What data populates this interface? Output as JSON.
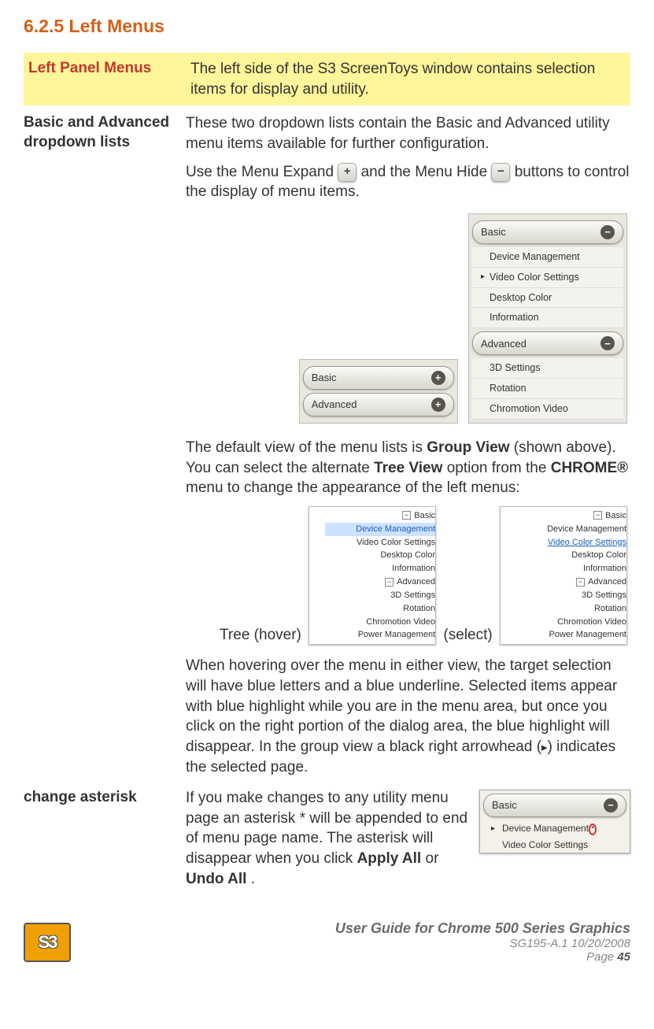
{
  "heading": "6.2.5 Left Menus",
  "rows": {
    "left_panel": {
      "label": "Left Panel Menus",
      "text": "The left side of the S3 ScreenToys window contains selection items for display and utility."
    },
    "dropdowns": {
      "label": "Basic and Advanced dropdown lists",
      "p1": "These two dropdown lists contain the Basic and Advanced utility menu items available for further configuration.",
      "p2a": "Use the Menu Expand ",
      "p2b": "and the Menu Hide ",
      "p2c": " buttons to control the display of menu items.",
      "expand_sym": "+",
      "hide_sym": "−",
      "p3a": "The default view of the menu lists is ",
      "p3b": "Group View",
      "p3c": " (shown above). You can select the alternate ",
      "p3d": "Tree View",
      "p3e": " option from the ",
      "p3f": "CHROME®",
      "p3g": " menu to change the appearance of the left menus:",
      "tree_hover_label": "Tree (hover)",
      "tree_select_label": " (select)",
      "p4a": "When hovering over the menu in either view, the target selection will have blue letters and a blue underline. Selected items appear with blue highlight while you are in the menu area, but once you click on the right portion of the dialog area, the blue highlight will disappear. In the group view a black right arrowhead (",
      "p4b": ") indicates the selected page.",
      "arrowhead": "▸"
    },
    "asterisk": {
      "label": "change asterisk",
      "p1": "If you make changes to any utility menu page an asterisk * will be appended to end of menu page name. The asterisk will disappear when you click ",
      "apply": "Apply All",
      "or": " or ",
      "undo": "Undo All",
      "period": "."
    }
  },
  "menus": {
    "basic_label": "Basic",
    "advanced_label": "Advanced",
    "plus": "+",
    "minus": "−",
    "minus_box": "−",
    "basic_items": [
      "Device Management",
      "Video Color Settings",
      "Desktop Color",
      "Information"
    ],
    "advanced_items": [
      "3D Settings",
      "Rotation",
      "Chromotion Video"
    ],
    "tree_basic_items": [
      "Device Management",
      "Video Color Settings",
      "Desktop Color",
      "Information"
    ],
    "tree_advanced_items": [
      "3D Settings",
      "Rotation",
      "Chromotion Video",
      "Power Management"
    ],
    "asterisk_item": "Device Management*",
    "asterisk_item2": "Video Color Settings"
  },
  "footer": {
    "logo": "S3",
    "title": "User Guide for Chrome 500 Series Graphics",
    "sub": "SG195-A.1   10/20/2008",
    "page_label": "Page ",
    "page_num": "45"
  }
}
